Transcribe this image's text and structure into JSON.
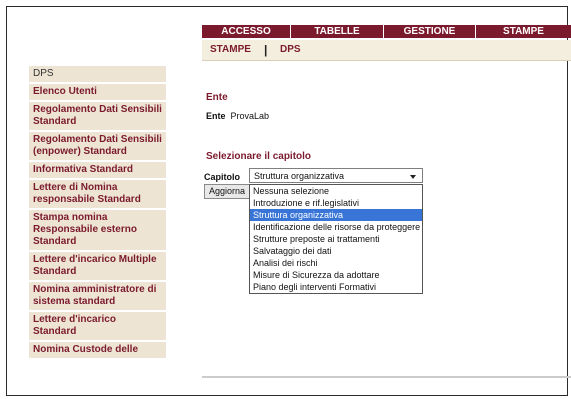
{
  "topnav": {
    "tabs": [
      {
        "label": "ACCESSO"
      },
      {
        "label": "TABELLE"
      },
      {
        "label": "GESTIONE"
      },
      {
        "label": "STAMPE"
      }
    ]
  },
  "subnav": {
    "item1": "STAMPE",
    "separator": "|",
    "item2": "DPS"
  },
  "sidebar": {
    "items": [
      {
        "label": "DPS"
      },
      {
        "label": "Elenco Utenti"
      },
      {
        "label": "Regolamento Dati Sensibili Standard"
      },
      {
        "label": "Regolamento Dati Sensibili (enpower) Standard"
      },
      {
        "label": "Informativa Standard"
      },
      {
        "label": "Lettere di Nomina responsabile Standard"
      },
      {
        "label": "Stampa nomina Responsabile esterno Standard"
      },
      {
        "label": "Lettere d'incarico Multiple Standard"
      },
      {
        "label": "Nomina amministratore di sistema standard"
      },
      {
        "label": "Lettere d'incarico Standard"
      },
      {
        "label": "Nomina Custode delle"
      }
    ]
  },
  "main": {
    "ente_title": "Ente",
    "ente_label": "Ente",
    "ente_value": "ProvaLab",
    "section_title": "Selezionare il capitolo",
    "capitolo_label": "Capitolo",
    "selected_value": "Struttura organizzativa",
    "button_label": "Aggiorna",
    "options": [
      "Nessuna selezione",
      "Introduzione e rif.legislativi",
      "Struttura organizzativa",
      "Identificazione delle risorse da proteggere",
      "Strutture preposte ai trattamenti",
      "Salvataggio dei dati",
      "Analisi dei rischi",
      "Misure di Sicurezza da adottare",
      "Piano degli interventi Formativi"
    ]
  }
}
